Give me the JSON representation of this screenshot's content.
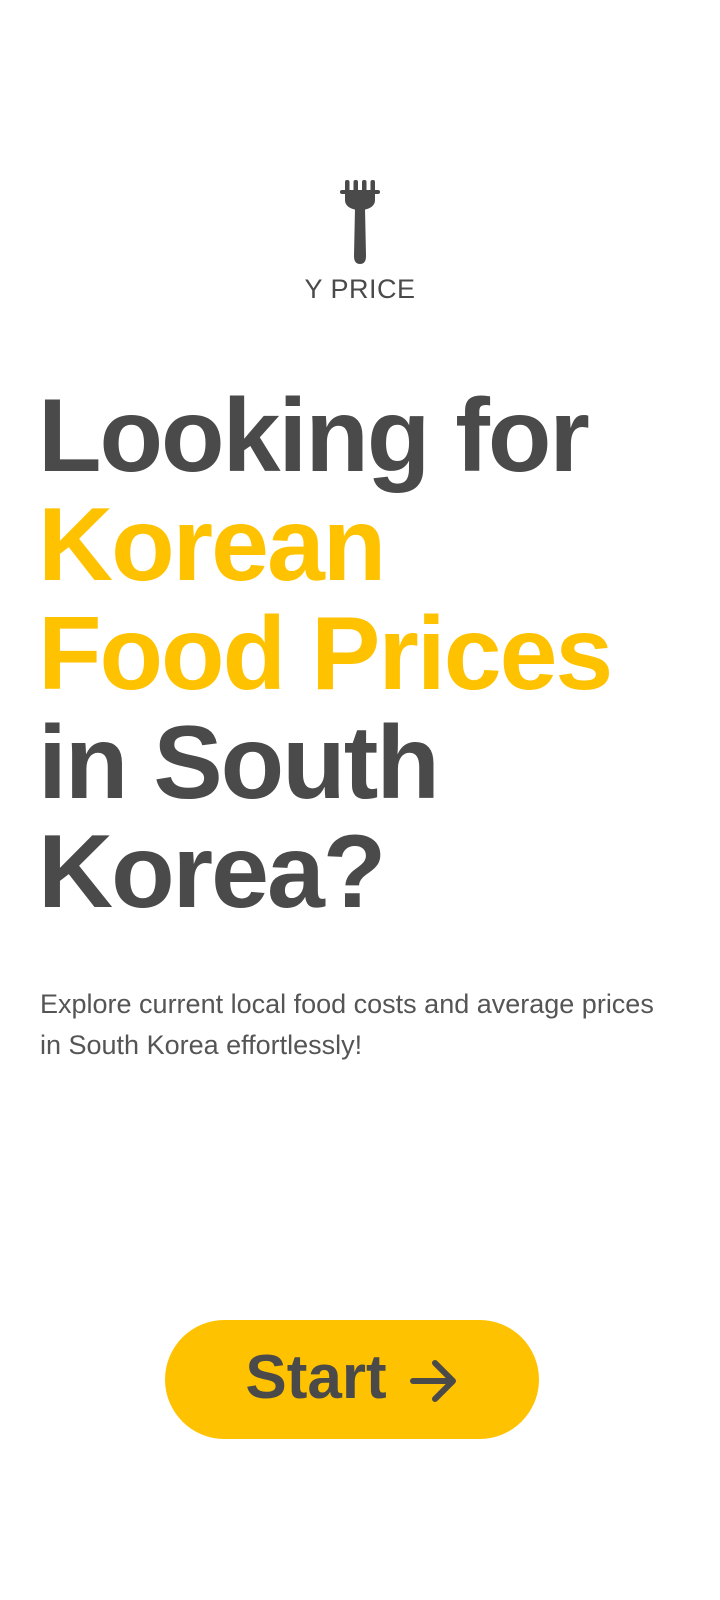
{
  "brand": {
    "logo_icon": "fork-icon",
    "name": "Y PRICE"
  },
  "hero": {
    "line1": "Looking for",
    "line2": "Korean",
    "line3": "Food Prices",
    "line4": "in South",
    "line5": "Korea?",
    "subtitle": "Explore current local food costs and average prices in South Korea effortlessly!"
  },
  "cta": {
    "label": "Start",
    "icon": "arrow-right-icon"
  },
  "colors": {
    "accent": "#ffc200",
    "text": "#4a4a4a",
    "background": "#ffffff"
  }
}
